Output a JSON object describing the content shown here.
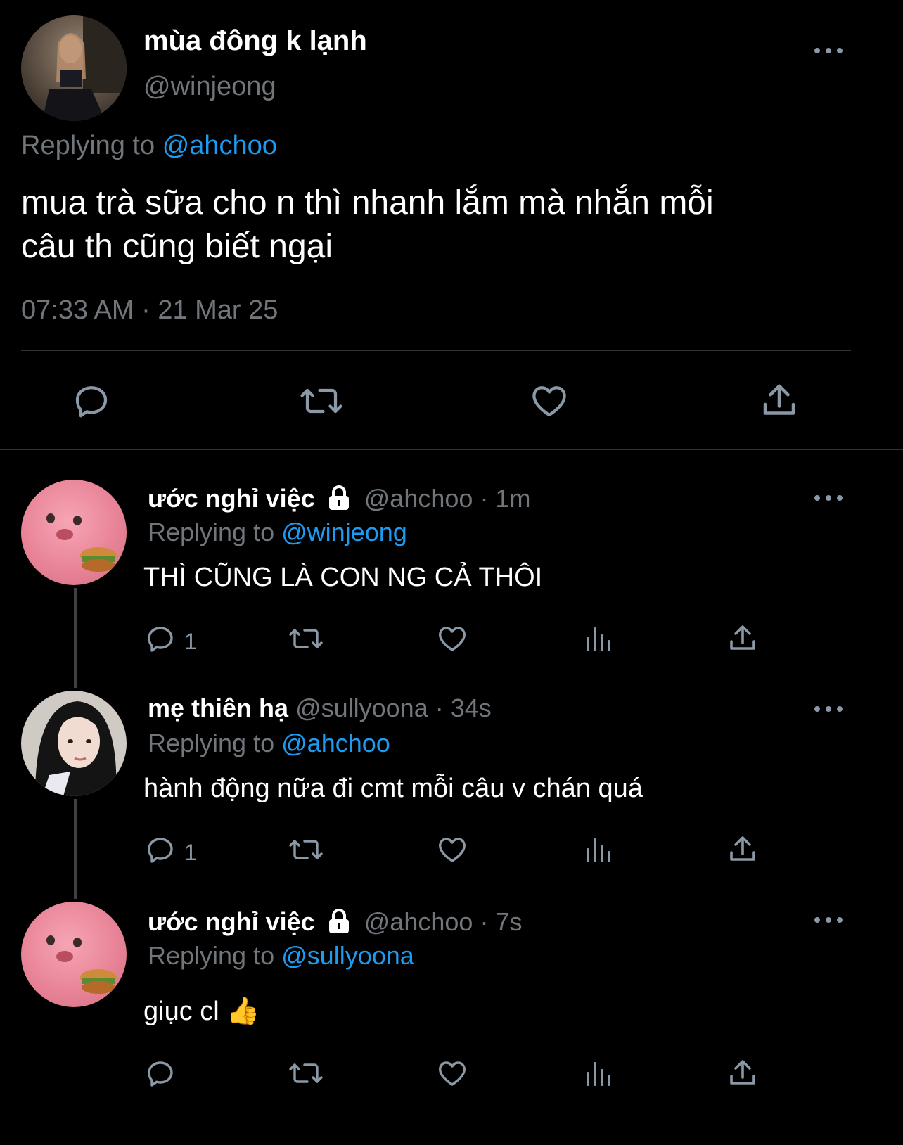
{
  "main_tweet": {
    "display_name": "mùa đông k lạnh",
    "handle": "@winjeong",
    "replying_label": "Replying to",
    "replying_to": "@ahchoo",
    "text_line1": "mua trà sữa cho n thì nhanh lắm mà nhắn mỗi",
    "text_line2": "câu th cũng biết ngại",
    "timestamp": "07:33 AM · 21 Mar 25"
  },
  "replies": [
    {
      "display_name": "ước nghỉ việc",
      "handle": "@ahchoo",
      "time": "· 1m",
      "replying_label": "Replying to",
      "replying_to": "@winjeong",
      "text": "THÌ CŨNG LÀ CON NG CẢ THÔI",
      "reply_count": "1"
    },
    {
      "display_name": "mẹ thiên hạ",
      "handle": "@sullyoona",
      "time": "· 34s",
      "replying_label": "Replying to",
      "replying_to": "@ahchoo",
      "text": "hành động nữa đi cmt mỗi câu v chán quá",
      "reply_count": "1"
    },
    {
      "display_name": "ước nghỉ việc",
      "handle": "@ahchoo",
      "time": "· 7s",
      "replying_label": "Replying to",
      "replying_to": "@sullyoona",
      "text": "giục cl 👍",
      "reply_count": ""
    }
  ],
  "colors": {
    "background": "#000000",
    "link": "#1d9bf0",
    "muted": "#71767b",
    "icon": "#8b98a5"
  },
  "icons": [
    "reply-icon",
    "retweet-icon",
    "like-icon",
    "share-icon",
    "views-icon",
    "lock-icon",
    "more-icon"
  ]
}
